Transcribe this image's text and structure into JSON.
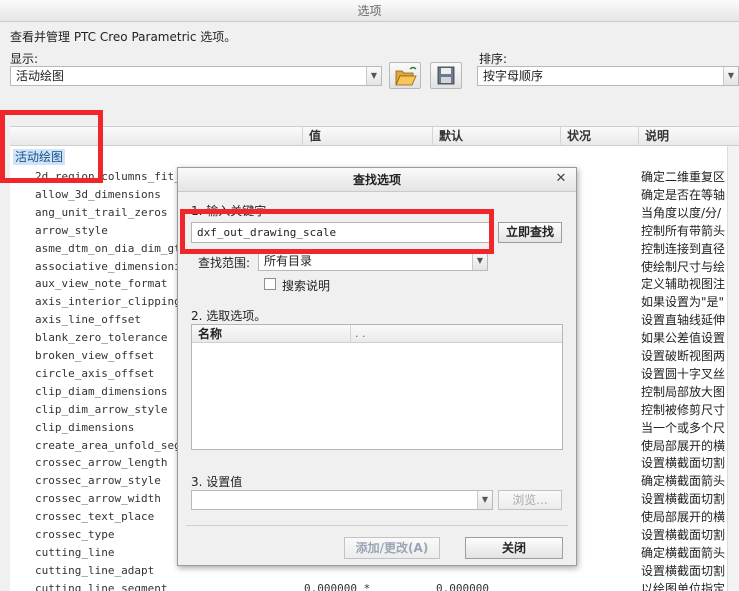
{
  "window": {
    "title": "选项"
  },
  "description": "查看并管理 PTC Creo Parametric 选项。",
  "display": {
    "label": "显示:",
    "value": "活动绘图"
  },
  "sort": {
    "label": "排序:",
    "value": "按字母顺序"
  },
  "icons": {
    "open": "folder-open-icon",
    "save": "floppy-save-icon"
  },
  "table": {
    "columns": [
      "值",
      "默认",
      "状况",
      "说明"
    ],
    "group": "活动绘图",
    "rows": [
      {
        "name": "2d_region_columns_fit_te",
        "explanation": "确定二维重复区"
      },
      {
        "name": "allow_3d_dimensions",
        "explanation": "确定是否在等轴"
      },
      {
        "name": "ang_unit_trail_zeros",
        "explanation": "当角度以度/分/"
      },
      {
        "name": "arrow_style",
        "explanation": "控制所有带箭头"
      },
      {
        "name": "asme_dtm_on_dia_dim_gtol",
        "explanation": "控制连接到直径"
      },
      {
        "name": "associative_dimensioning",
        "explanation": "使绘制尺寸与绘"
      },
      {
        "name": "aux_view_note_format",
        "explanation": "定义辅助视图注"
      },
      {
        "name": "axis_interior_clipping",
        "explanation": "如果设置为\"是\""
      },
      {
        "name": "axis_line_offset",
        "explanation": "设置直轴线延伸"
      },
      {
        "name": "blank_zero_tolerance",
        "explanation": "如果公差值设置"
      },
      {
        "name": "broken_view_offset",
        "explanation": "设置破断视图两"
      },
      {
        "name": "circle_axis_offset",
        "explanation": "设置圆十字叉丝"
      },
      {
        "name": "clip_diam_dimensions",
        "explanation": "控制局部放大图"
      },
      {
        "name": "clip_dim_arrow_style",
        "explanation": "控制被修剪尺寸"
      },
      {
        "name": "clip_dimensions",
        "explanation": "当一个或多个尺"
      },
      {
        "name": "create_area_unfold_segme",
        "explanation": "使局部展开的横"
      },
      {
        "name": "crossec_arrow_length",
        "explanation": "设置横截面切割"
      },
      {
        "name": "crossec_arrow_style",
        "explanation": "确定横截面箭头"
      },
      {
        "name": "crossec_arrow_width",
        "explanation": "设置横截面切割"
      },
      {
        "name": "crossec_text_place",
        "explanation": "使局部展开的横"
      },
      {
        "name": "crossec_type",
        "explanation": "设置横截面切割"
      },
      {
        "name": "cutting_line",
        "explanation": "确定横截面箭头"
      },
      {
        "name": "cutting_line_adapt",
        "explanation": "设置横截面切割"
      },
      {
        "name": "cutting_line_segment",
        "value": "0.000000 *",
        "default": "0.000000",
        "explanation": "以绘图单位指定"
      }
    ]
  },
  "dialog": {
    "title": "查找选项",
    "close_glyph": "✕",
    "step1": "1. 输入关键字",
    "keyword": "dxf_out_drawing_scale",
    "find_label": "立即查找",
    "scope_label": "查找范围:",
    "scope_value": "所有目录",
    "search_desc_label": "搜索说明",
    "step2": "2. 选取选项。",
    "list_columns": [
      "名称",
      ". ."
    ],
    "step3": "3. 设置值",
    "browse_label": "浏览...",
    "add_label": "添加/更改(A)",
    "close_label": "关闭"
  }
}
